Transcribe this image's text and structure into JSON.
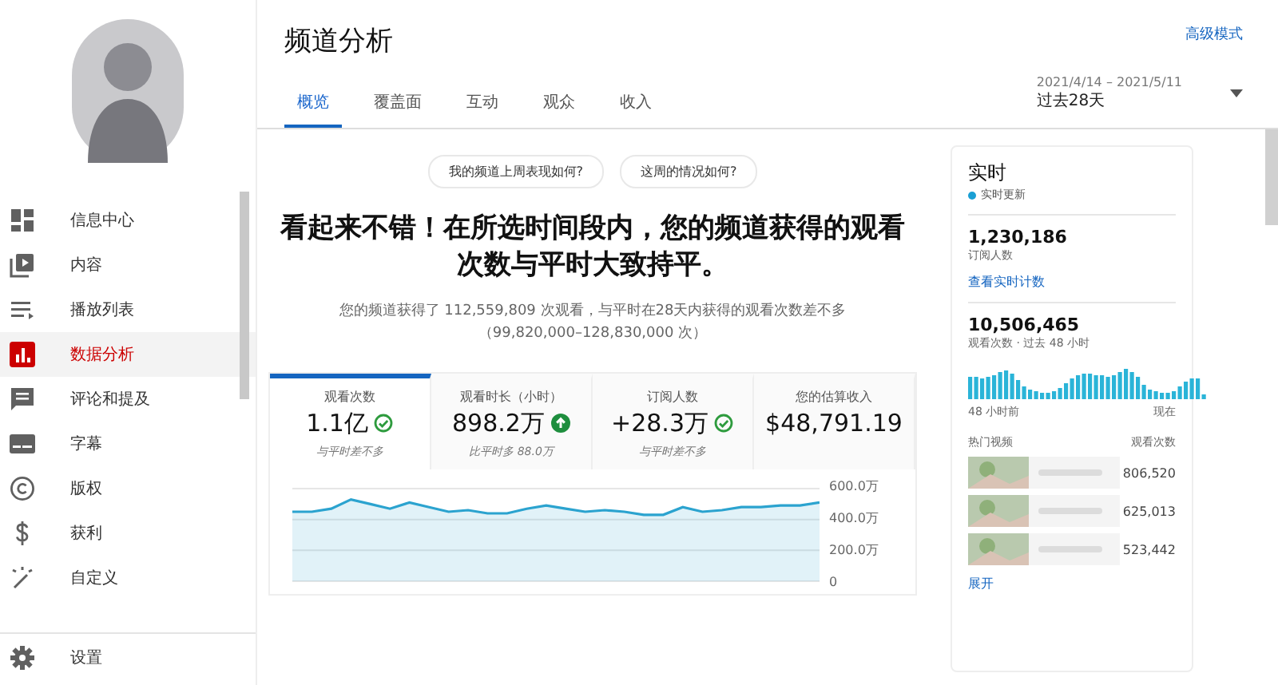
{
  "sidebar": {
    "items": [
      {
        "label": "信息中心",
        "kind": "dashboard",
        "selected": false
      },
      {
        "label": "内容",
        "kind": "video",
        "selected": false
      },
      {
        "label": "播放列表",
        "kind": "playlist",
        "selected": false
      },
      {
        "label": "数据分析",
        "kind": "chart",
        "selected": true
      },
      {
        "label": "评论和提及",
        "kind": "comment",
        "selected": false
      },
      {
        "label": "字幕",
        "kind": "subtitle",
        "selected": false
      },
      {
        "label": "版权",
        "kind": "copyright",
        "selected": false
      },
      {
        "label": "获利",
        "kind": "dollar",
        "selected": false
      },
      {
        "label": "自定义",
        "kind": "magic",
        "selected": false
      }
    ],
    "footer": {
      "label": "设置",
      "kind": "gear"
    }
  },
  "header": {
    "title": "频道分析",
    "advanced_link": "高级模式"
  },
  "tabs": [
    {
      "label": "概览",
      "selected": true
    },
    {
      "label": "覆盖面",
      "selected": false
    },
    {
      "label": "互动",
      "selected": false
    },
    {
      "label": "观众",
      "selected": false
    },
    {
      "label": "收入",
      "selected": false
    }
  ],
  "date_range": {
    "dates": "2021/4/14 – 2021/5/11",
    "label": "过去28天"
  },
  "questions": [
    "我的频道上周表现如何?",
    "这周的情况如何?"
  ],
  "headline": "看起来不错！在所选时间段内，您的频道获得的观看次数与平时大致持平。",
  "summary": "您的频道获得了 112,559,809 次观看，与平时在28天内获得的观看次数差不多（99,820,000–128,830,000 次）",
  "metrics": [
    {
      "label": "观看次数",
      "value": "1.1亿",
      "kind": "check",
      "note": "与平时差不多",
      "selected": true
    },
    {
      "label": "观看时长（小时）",
      "value": "898.2万",
      "kind": "up",
      "note": "比平时多 88.0万",
      "selected": false
    },
    {
      "label": "订阅人数",
      "value": "+28.3万",
      "kind": "check",
      "note": "与平时差不多",
      "selected": false
    },
    {
      "label": "您的估算收入",
      "value": "$48,791.19",
      "kind": "plain",
      "selected": false
    }
  ],
  "chart_data": {
    "type": "area",
    "ylim": [
      0,
      600
    ],
    "yticks": [
      {
        "value": 0,
        "label": "0"
      },
      {
        "value": 200,
        "label": "200.0万"
      },
      {
        "value": 400,
        "label": "400.0万"
      },
      {
        "value": 600,
        "label": "600.0万"
      }
    ],
    "series": [
      {
        "color": "#2ba3cf",
        "values": [
          450,
          450,
          470,
          530,
          500,
          470,
          510,
          480,
          450,
          460,
          440,
          440,
          470,
          490,
          470,
          450,
          460,
          450,
          430,
          430,
          480,
          450,
          460,
          480,
          480,
          490,
          490,
          510
        ]
      }
    ]
  },
  "realtime": {
    "title": "实时",
    "status": "实时更新",
    "subscribers": {
      "value": "1,230,186",
      "label": "订阅人数",
      "link": "查看实时计数"
    },
    "views": {
      "value": "10,506,465",
      "label": "观看次数 · 过去 48 小时",
      "start_label": "48 小时前",
      "end_label": "现在"
    },
    "top_videos": {
      "column_1": "热门视频",
      "column_2": "观看次数",
      "rows": [
        {
          "views": "806,520"
        },
        {
          "views": "625,013"
        },
        {
          "views": "523,442"
        }
      ]
    },
    "expand": "展开"
  }
}
